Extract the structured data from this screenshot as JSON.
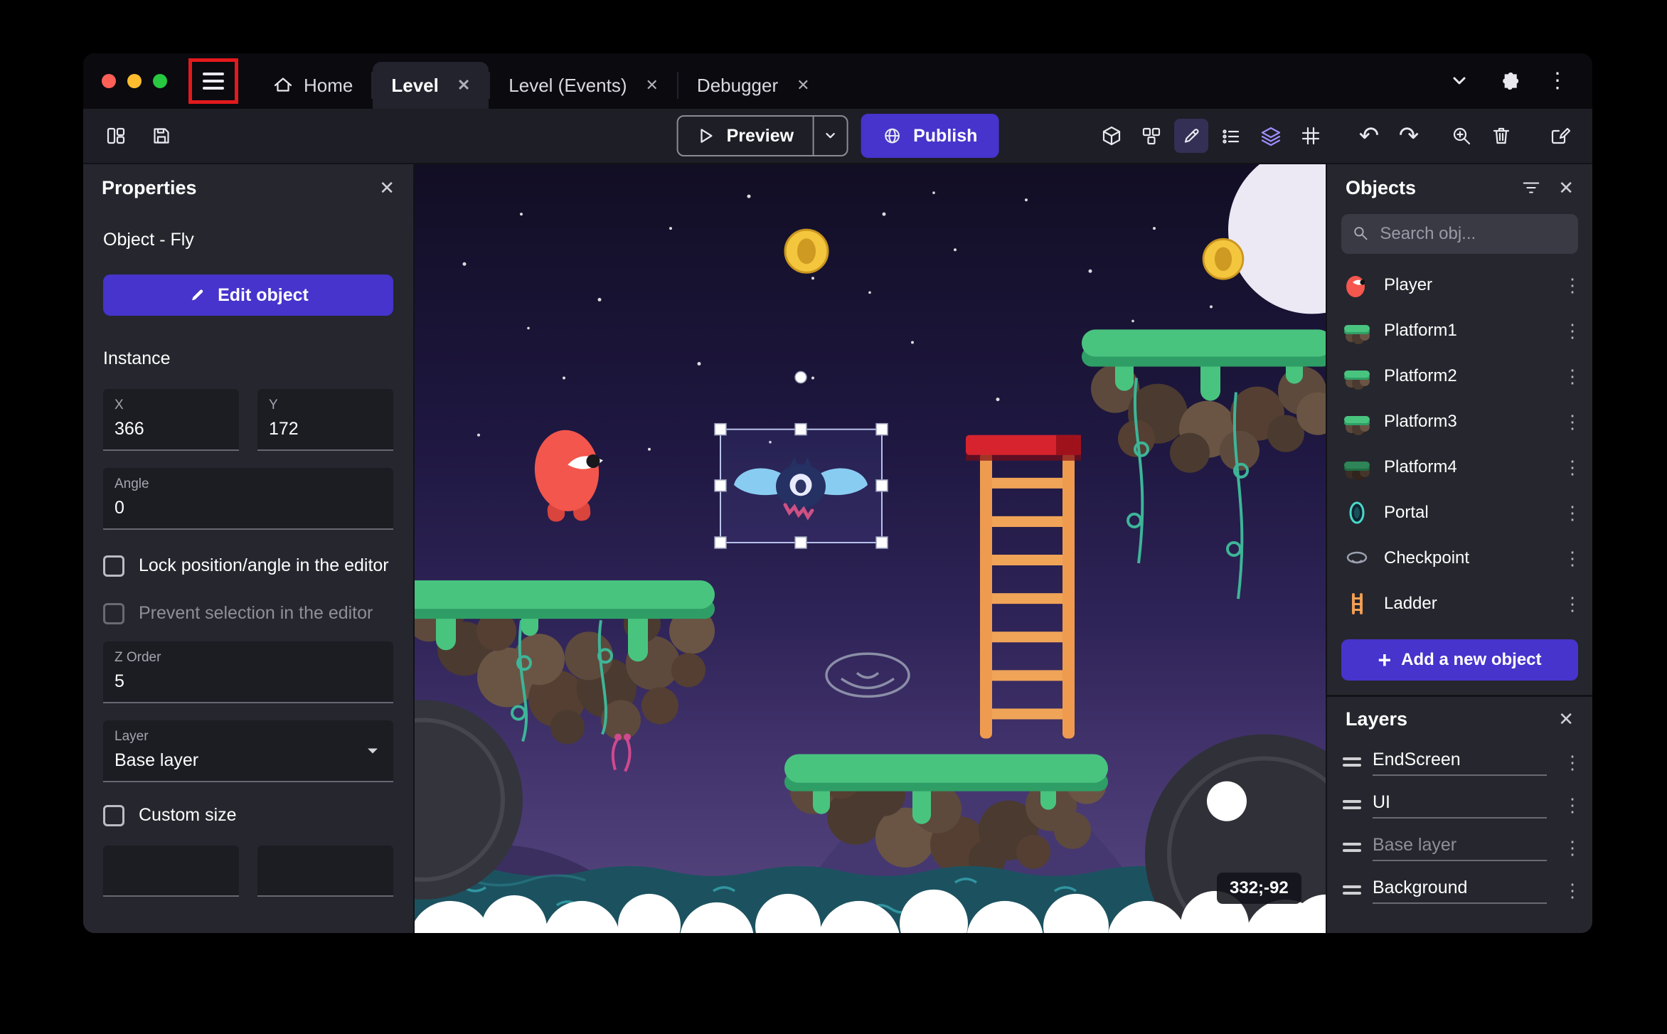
{
  "window": {
    "controls": {
      "close": "#ff5f57",
      "minimize": "#febc2e",
      "maximize": "#28c840"
    },
    "tabs": [
      {
        "label": "Home"
      },
      {
        "label": "Level",
        "active": true
      },
      {
        "label": "Level (Events)"
      },
      {
        "label": "Debugger"
      }
    ]
  },
  "toolbar": {
    "preview_label": "Preview",
    "publish_label": "Publish"
  },
  "properties": {
    "title": "Properties",
    "object_label": "Object  - Fly",
    "edit_object_label": "Edit object",
    "instance_label": "Instance",
    "x_label": "X",
    "x_value": "366",
    "y_label": "Y",
    "y_value": "172",
    "angle_label": "Angle",
    "angle_value": "0",
    "lock_label": "Lock position/angle in the editor",
    "prevent_label": "Prevent selection in the editor",
    "z_label": "Z Order",
    "z_value": "5",
    "layer_label": "Layer",
    "layer_value": "Base layer",
    "custom_size_label": "Custom size"
  },
  "objects_panel": {
    "title": "Objects",
    "search_placeholder": "Search obj...",
    "items": [
      {
        "name": "Player"
      },
      {
        "name": "Platform1"
      },
      {
        "name": "Platform2"
      },
      {
        "name": "Platform3"
      },
      {
        "name": "Platform4"
      },
      {
        "name": "Portal"
      },
      {
        "name": "Checkpoint"
      },
      {
        "name": "Ladder"
      }
    ],
    "add_button_label": "Add a new object"
  },
  "layers_panel": {
    "title": "Layers",
    "items": [
      {
        "name": "EndScreen"
      },
      {
        "name": "UI"
      },
      {
        "name": "Base layer",
        "dim": true
      },
      {
        "name": "Background"
      }
    ]
  },
  "canvas": {
    "coordinates": "332;-92"
  },
  "icons": {
    "close": "✕",
    "kebab": "⋮",
    "plus": "+"
  },
  "colors": {
    "accent": "#4634cc",
    "annotation_red": "#e3191c",
    "selection": "#b9c2ea"
  }
}
